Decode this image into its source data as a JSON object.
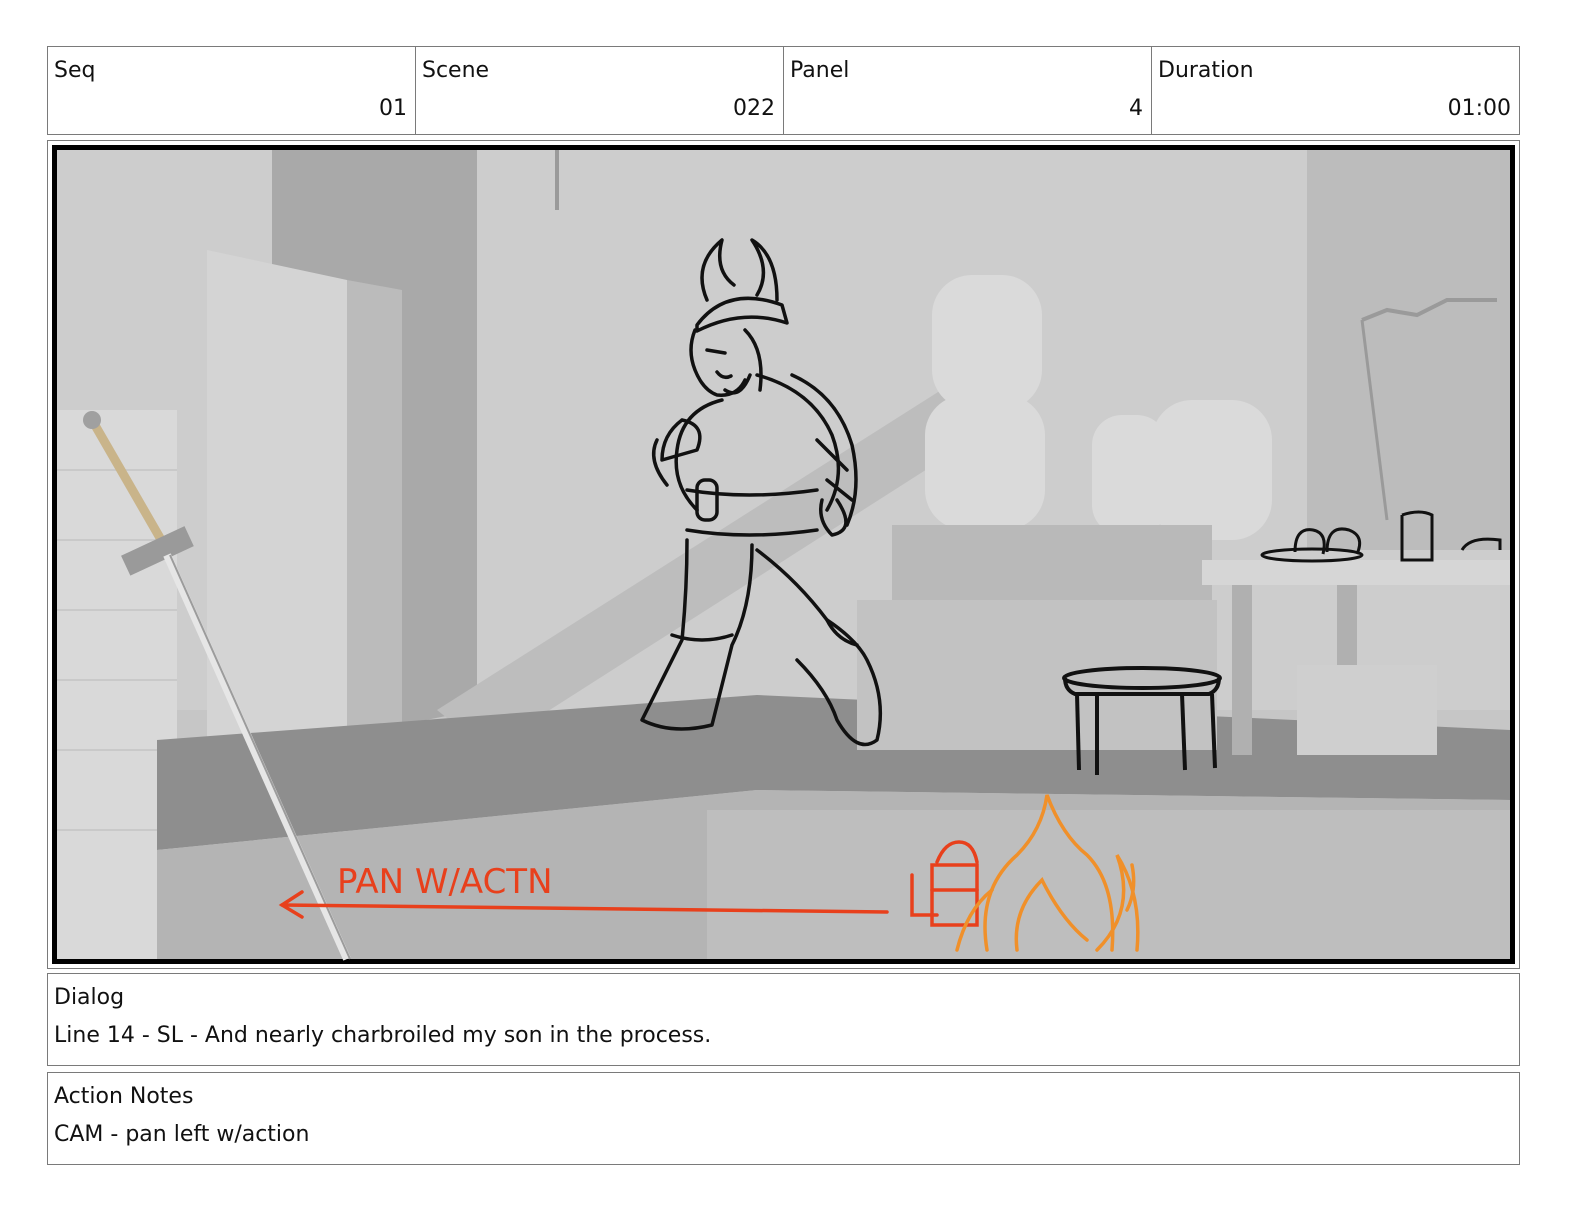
{
  "header": {
    "seq_label": "Seq",
    "seq_value": "01",
    "scene_label": "Scene",
    "scene_value": "022",
    "panel_label": "Panel",
    "panel_value": "4",
    "duration_label": "Duration",
    "duration_value": "01:00"
  },
  "sketch": {
    "annotation": "PAN W/ACTN"
  },
  "dialog": {
    "label": "Dialog",
    "text": "Line 14 - SL - And nearly charbroiled my son in the process."
  },
  "action_notes": {
    "label": "Action Notes",
    "text": "CAM - pan left w/action"
  },
  "colors": {
    "annotation_red": "#e8401c",
    "fire_orange": "#f0902a",
    "background_gray": "#c4c4c4"
  }
}
